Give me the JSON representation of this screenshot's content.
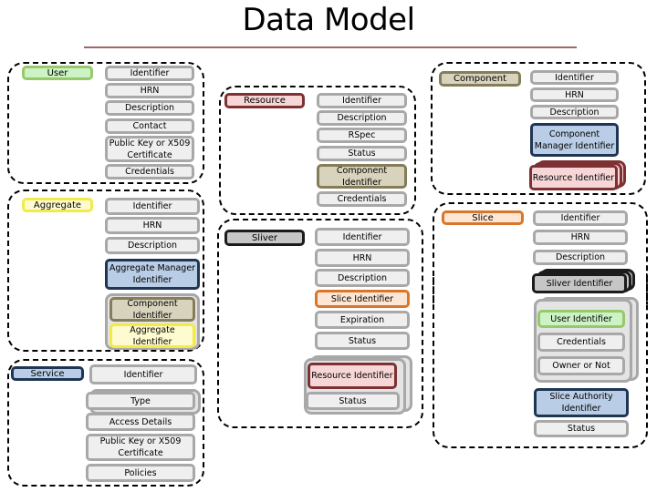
{
  "title": "Data Model",
  "groups": {
    "user": {
      "entity": "User",
      "fields": [
        "Identifier",
        "HRN",
        "Description",
        "Contact",
        "Public Key or X509 Certificate",
        "Credentials"
      ]
    },
    "aggregate": {
      "entity": "Aggregate",
      "fields": [
        "Identifier",
        "HRN",
        "Description",
        "Aggregate Manager Identifier",
        "Component Identifier",
        "Aggregate Identifier"
      ]
    },
    "service": {
      "entity": "Service",
      "fields": [
        "Identifier",
        "Type",
        "Access Details",
        "Public Key or X509 Certificate",
        "Policies"
      ]
    },
    "resource": {
      "entity": "Resource",
      "fields": [
        "Identifier",
        "Description",
        "RSpec",
        "Status",
        "Component Identifier",
        "Credentials"
      ]
    },
    "sliver": {
      "entity": "Sliver",
      "fields": [
        "Identifier",
        "HRN",
        "Description",
        "Slice Identifier",
        "Expiration",
        "Status",
        "Resource Identifier",
        "Status"
      ]
    },
    "component": {
      "entity": "Component",
      "fields": [
        "Identifier",
        "HRN",
        "Description",
        "Component Manager Identifier",
        "Resource Identifier"
      ]
    },
    "slice": {
      "entity": "Slice",
      "fields": [
        "Identifier",
        "HRN",
        "Description",
        "Sliver Identifier",
        "User Identifier",
        "Credentials",
        "Owner or Not",
        "Slice Authority Identifier",
        "Status"
      ]
    }
  },
  "colors": {
    "user": "#96c96a",
    "aggregate": "#f2ea48",
    "service": "#1e3553",
    "resource": "#7e3033",
    "component": "#857c58",
    "slice": "#d8772c",
    "sliver": "#1b1b1b",
    "field": "#a8a8a8"
  }
}
